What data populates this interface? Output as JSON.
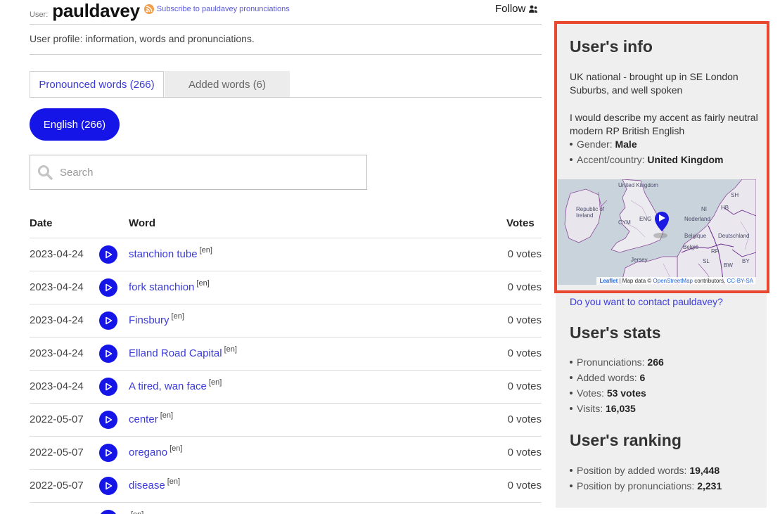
{
  "header": {
    "user_prefix": "User:",
    "username": "pauldavey",
    "subscribe_label": "Subscribe to pauldavey pronunciations",
    "follow_label": "Follow",
    "profile_description": "User profile: information, words and pronunciations."
  },
  "tabs": [
    {
      "label": "Pronounced words (266)"
    },
    {
      "label": "Added words (6)"
    }
  ],
  "language_filter": {
    "label": "English (266)"
  },
  "search": {
    "placeholder": "Search",
    "value": ""
  },
  "table": {
    "headers": {
      "date": "Date",
      "word": "Word",
      "votes": "Votes"
    },
    "rows": [
      {
        "date": "2023-04-24",
        "word": "stanchion tube",
        "lang": "[en]",
        "votes": "0 votes"
      },
      {
        "date": "2023-04-24",
        "word": "fork stanchion",
        "lang": "[en]",
        "votes": "0 votes"
      },
      {
        "date": "2023-04-24",
        "word": "Finsbury",
        "lang": "[en]",
        "votes": "0 votes"
      },
      {
        "date": "2023-04-24",
        "word": "Elland Road Capital",
        "lang": "[en]",
        "votes": "0 votes"
      },
      {
        "date": "2023-04-24",
        "word": "A tired, wan face",
        "lang": "[en]",
        "votes": "0 votes"
      },
      {
        "date": "2022-05-07",
        "word": "center",
        "lang": "[en]",
        "votes": "0 votes"
      },
      {
        "date": "2022-05-07",
        "word": "oregano",
        "lang": "[en]",
        "votes": "0 votes"
      },
      {
        "date": "2022-05-07",
        "word": "disease",
        "lang": "[en]",
        "votes": "0 votes"
      },
      {
        "date": "",
        "word": "",
        "lang": "[en]",
        "votes": ""
      }
    ]
  },
  "sidebar": {
    "info_title": "User's info",
    "info_para1": "UK national - brought up in SE London Suburbs, and well spoken",
    "info_para2": "I would describe my accent as fairly neutral modern RP British English",
    "gender_label": "Gender:",
    "gender_value": "Male",
    "accent_label": "Accent/country:",
    "accent_value": "United Kingdom",
    "map": {
      "labels": [
        "United Kingdom",
        "Republic of Ireland",
        "CYM",
        "ENG",
        "Nederland",
        "Belgique",
        "België",
        "Deutschland",
        "Jersey",
        "SH",
        "HB",
        "NI",
        "RP",
        "BY",
        "BW",
        "SL"
      ],
      "attribution_leaflet": "Leaflet",
      "attribution_map_data": "| Map data ©",
      "attribution_osm": "OpenStreetMap",
      "attribution_contributors": "contributors,",
      "attribution_license": "CC-BY-SA"
    },
    "contact_link": "Do you want to contact pauldavey?",
    "stats_title": "User's stats",
    "stats": [
      {
        "label": "Pronunciations:",
        "value": "266"
      },
      {
        "label": "Added words:",
        "value": "6"
      },
      {
        "label": "Votes:",
        "value": "53 votes"
      },
      {
        "label": "Visits:",
        "value": "16,035"
      }
    ],
    "ranking_title": "User's ranking",
    "ranking": [
      {
        "label": "Position by added words:",
        "value": "19,448"
      },
      {
        "label": "Position by pronunciations:",
        "value": "2,231"
      }
    ]
  },
  "colors": {
    "accent": "#1515e8",
    "link": "#3a3ad9",
    "highlight": "#e8482e",
    "sidebar_bg": "#efefef"
  }
}
